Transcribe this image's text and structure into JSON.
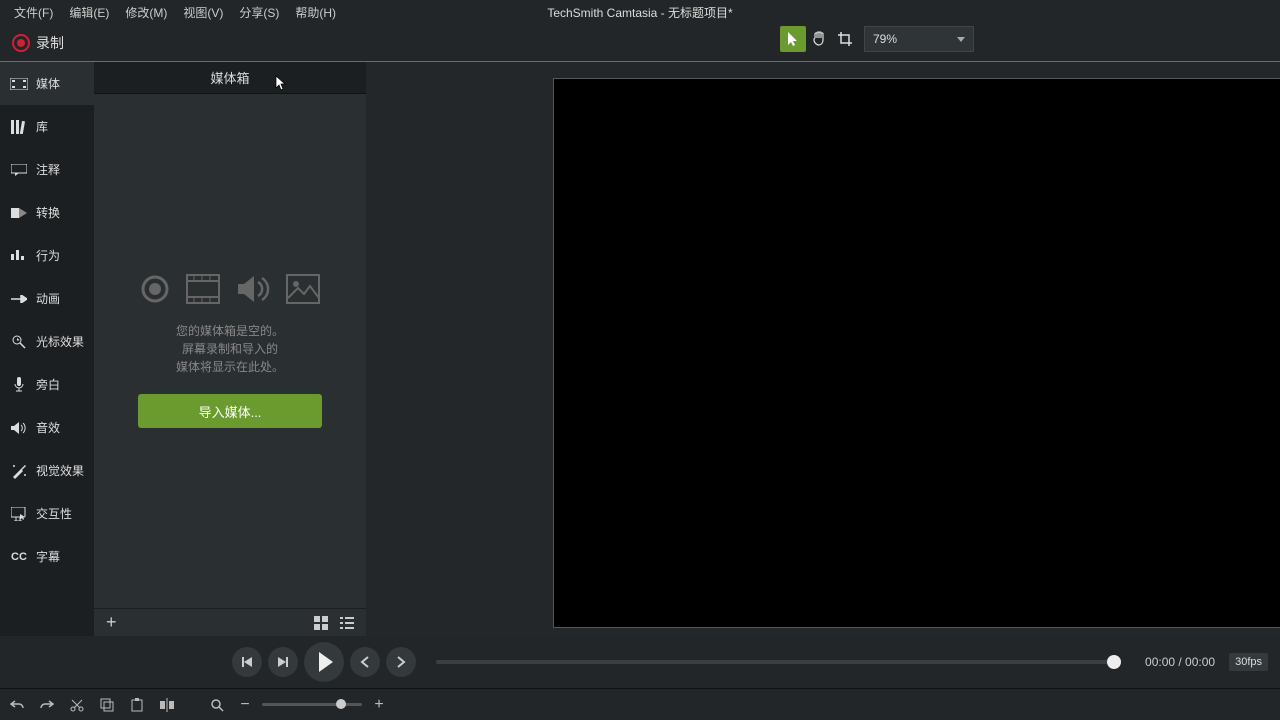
{
  "menu": {
    "file": "文件(F)",
    "edit": "编辑(E)",
    "modify": "修改(M)",
    "view": "视图(V)",
    "share": "分享(S)",
    "help": "帮助(H)"
  },
  "title": "TechSmith Camtasia - 无标题项目*",
  "record_label": "录制",
  "zoom_value": "79%",
  "sidebar": {
    "media": "媒体",
    "library": "库",
    "annotations": "注释",
    "transitions": "转换",
    "behaviors": "行为",
    "animations": "动画",
    "cursor_fx": "光标效果",
    "voice": "旁白",
    "audio_fx": "音效",
    "visual_fx": "视觉效果",
    "interactivity": "交互性",
    "captions": "字幕"
  },
  "panel": {
    "header": "媒体箱",
    "empty_l1": "您的媒体箱是空的。",
    "empty_l2": "屏幕录制和导入的",
    "empty_l3": "媒体将显示在此处。",
    "import_button": "导入媒体..."
  },
  "playback": {
    "time": "00:00 / 00:00",
    "fps": "30fps"
  },
  "icons": {
    "media": "media-icon",
    "library": "library-icon",
    "annotations": "annotation-icon",
    "transitions": "transition-icon",
    "behaviors": "behavior-icon",
    "animations": "animation-icon",
    "cursor_fx": "cursor-effects-icon",
    "voice": "voice-icon",
    "audio_fx": "audio-fx-icon",
    "visual_fx": "visual-fx-icon",
    "interactivity": "interactivity-icon",
    "captions": "captions-icon"
  }
}
